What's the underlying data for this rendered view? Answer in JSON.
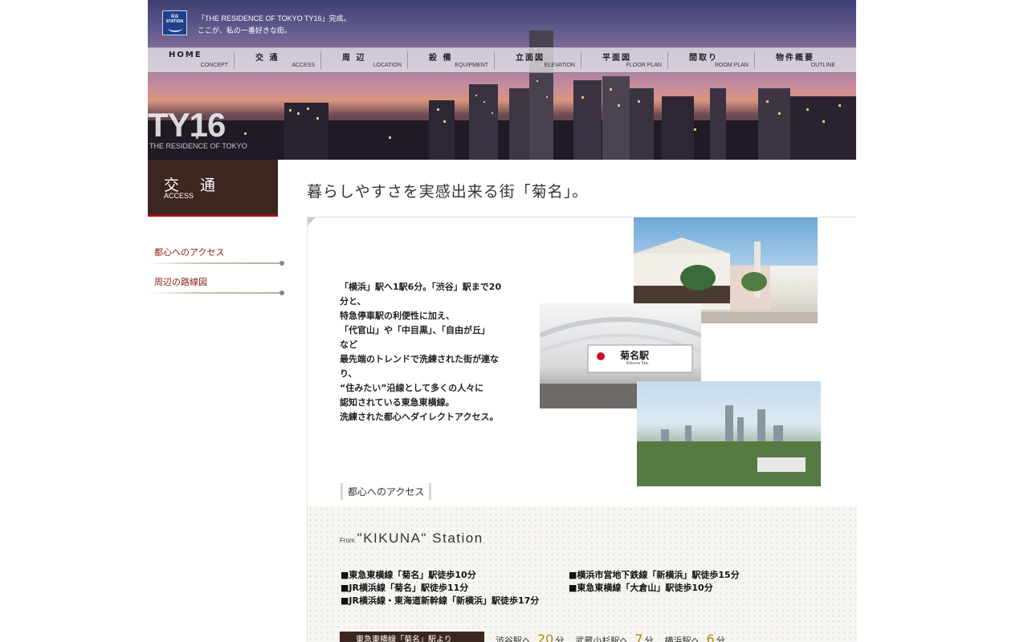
{
  "header": {
    "logo_line1": "電鉄",
    "logo_line2": "STATION",
    "tagline_line1": "「THE RESIDENCE OF TOKYO TY16」完成。",
    "tagline_line2": "ここが、私の一番好きな街。",
    "brand": "TY16",
    "brand_sub": "THE RESIDENCE OF TOKYO"
  },
  "nav": [
    {
      "jp": "HOME",
      "en": "CONCEPT"
    },
    {
      "jp": "交 通",
      "en": "ACCESS"
    },
    {
      "jp": "周 辺",
      "en": "LOCATION"
    },
    {
      "jp": "設 備",
      "en": "EQUIPMENT"
    },
    {
      "jp": "立面図",
      "en": "ELEVATION"
    },
    {
      "jp": "平面図",
      "en": "FLOOR PLAN"
    },
    {
      "jp": "間取り",
      "en": "ROOM PLAN"
    },
    {
      "jp": "物件概要",
      "en": "OUTLINE"
    }
  ],
  "sidebar": {
    "title_jp": "交 通",
    "title_en": "ACCESS",
    "links": [
      "都心へのアクセス",
      "周辺の路線図"
    ]
  },
  "main": {
    "title": "暮らしやすさを実感出来る街「菊名」。",
    "intro": "「横浜」駅へ1駅6分。「渋谷」駅まで20\n分と、\n特急停車駅の利便性に加え、\n「代官山」や「中目黒」、「自由が丘」\nなど\n最先端のトレンドで洗練された街が連な\nり、\n“住みたい”沿線として多くの人々に\n認知されている東急東横線。\n洗練された都心へダイレクトアクセス。",
    "station_sign": "菊名駅",
    "station_sign_en": "Kikuna Sta.",
    "section_label": "都心へのアクセス",
    "station_from": "From",
    "station_name": "\"KIKUNA\" Station",
    "lines_left": [
      "■東急東横線「菊名」駅徒歩10分",
      "■JR横浜線「菊名」駅徒歩11分",
      "■JR横浜線・東海道新幹線「新横浜」駅徒歩17分"
    ],
    "lines_right": [
      "■横浜市営地下鉄線「新横浜」駅徒歩15分",
      "■東急東横線「大倉山」駅徒歩10分"
    ],
    "times_label": "東急東横線「菊名」駅より",
    "times": [
      {
        "dest": "渋谷駅へ",
        "num": "20",
        "unit": "分"
      },
      {
        "dest": "武蔵小杉駅へ",
        "num": "7",
        "unit": "分"
      },
      {
        "dest": "横浜駅へ",
        "num": "6",
        "unit": "分"
      }
    ]
  },
  "colors": {
    "accent_dark": "#3b2620",
    "accent_red": "#a31212",
    "link_red": "#8e1a14",
    "gold": "#b8860b"
  }
}
